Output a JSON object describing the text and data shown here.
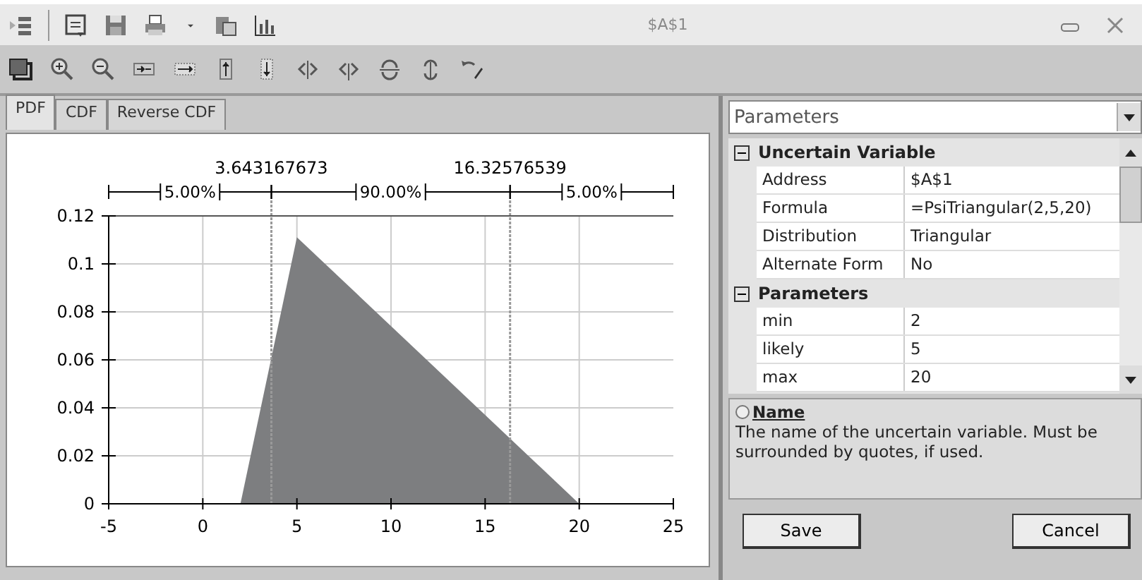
{
  "window": {
    "title": "$A$1"
  },
  "tabs": [
    {
      "label": "PDF",
      "selected": true
    },
    {
      "label": "CDF",
      "selected": false
    },
    {
      "label": "Reverse CDF",
      "selected": false
    }
  ],
  "chart": {
    "bands": [
      "5.00%",
      "90.00%",
      "5.00%"
    ],
    "chart_data": {
      "type": "area",
      "x": [
        2,
        5,
        20
      ],
      "series": [
        {
          "color": "#7d7e80",
          "values": [
            0,
            0.1111,
            0
          ]
        }
      ],
      "xlim": [
        -5,
        25
      ],
      "ylim": [
        0,
        0.12
      ],
      "xticks": [
        -5,
        0,
        5,
        10,
        15,
        20,
        25
      ],
      "yticks": [
        0,
        0.02,
        0.04,
        0.06,
        0.08,
        0.1,
        0.12
      ],
      "grid": true,
      "ref_lines": [
        {
          "axis": "x",
          "value": 3.643167673,
          "label": "3.643167673"
        },
        {
          "axis": "x",
          "value": 16.32576539,
          "label": "16.32576539"
        }
      ]
    }
  },
  "panel": {
    "dropdown": "Parameters",
    "categories": [
      {
        "name": "Uncertain Variable",
        "expanded": true,
        "rows": [
          {
            "name": "Address",
            "value": "$A$1"
          },
          {
            "name": "Formula",
            "value": "=PsiTriangular(2,5,20)"
          },
          {
            "name": "Distribution",
            "value": "Triangular"
          },
          {
            "name": "Alternate Form",
            "value": "No"
          }
        ]
      },
      {
        "name": "Parameters",
        "expanded": true,
        "rows": [
          {
            "name": "min",
            "value": "2"
          },
          {
            "name": "likely",
            "value": "5"
          },
          {
            "name": "max",
            "value": "20"
          }
        ]
      }
    ],
    "help": {
      "title": "Name",
      "text": "The name of the uncertain variable. Must be surrounded by quotes, if used."
    },
    "buttons": [
      "Save",
      "Cancel"
    ]
  }
}
